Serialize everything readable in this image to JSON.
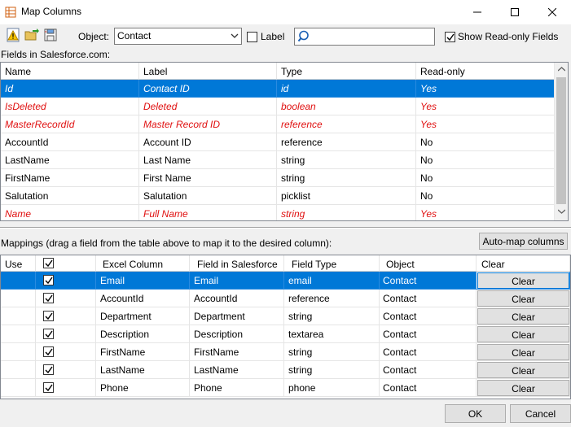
{
  "window": {
    "title": "Map Columns",
    "minimize_icon": "minimize-icon",
    "maximize_icon": "maximize-icon",
    "close_icon": "close-icon"
  },
  "toolbar": {
    "icons": [
      "warning-document-icon",
      "open-folder-icon",
      "save-disk-icon"
    ],
    "object_label": "Object:",
    "object_value": "Contact",
    "label_checkbox": {
      "label": "Label",
      "checked": false
    },
    "search_value": "",
    "show_readonly": {
      "label": "Show Read-only Fields",
      "checked": true
    }
  },
  "fields": {
    "caption": "Fields in Salesforce.com:",
    "columns": [
      "Name",
      "Label",
      "Type",
      "Read-only"
    ],
    "rows": [
      {
        "name": "Id",
        "label": "Contact ID",
        "type": "id",
        "readonly": "Yes",
        "selected": true,
        "ro": true
      },
      {
        "name": "IsDeleted",
        "label": "Deleted",
        "type": "boolean",
        "readonly": "Yes",
        "selected": false,
        "ro": true
      },
      {
        "name": "MasterRecordId",
        "label": "Master Record ID",
        "type": "reference",
        "readonly": "Yes",
        "selected": false,
        "ro": true
      },
      {
        "name": "AccountId",
        "label": "Account ID",
        "type": "reference",
        "readonly": "No",
        "selected": false,
        "ro": false
      },
      {
        "name": "LastName",
        "label": "Last Name",
        "type": "string",
        "readonly": "No",
        "selected": false,
        "ro": false
      },
      {
        "name": "FirstName",
        "label": "First Name",
        "type": "string",
        "readonly": "No",
        "selected": false,
        "ro": false
      },
      {
        "name": "Salutation",
        "label": "Salutation",
        "type": "picklist",
        "readonly": "No",
        "selected": false,
        "ro": false
      },
      {
        "name": "Name",
        "label": "Full Name",
        "type": "string",
        "readonly": "Yes",
        "selected": false,
        "ro": true
      }
    ]
  },
  "mappings": {
    "caption": "Mappings (drag a field from the table above to map it to the desired column):",
    "automap_label": "Auto-map columns",
    "columns": [
      "Use",
      "Excel Column",
      "Field in Salesforce",
      "Field Type",
      "Object",
      "Clear"
    ],
    "header_checked": true,
    "rows": [
      {
        "use": true,
        "excel": "Email",
        "field": "Email",
        "type": "email",
        "object": "Contact",
        "clear": "Clear",
        "selected": true
      },
      {
        "use": true,
        "excel": "AccountId",
        "field": "AccountId",
        "type": "reference",
        "object": "Contact",
        "clear": "Clear",
        "selected": false
      },
      {
        "use": true,
        "excel": "Department",
        "field": "Department",
        "type": "string",
        "object": "Contact",
        "clear": "Clear",
        "selected": false
      },
      {
        "use": true,
        "excel": "Description",
        "field": "Description",
        "type": "textarea",
        "object": "Contact",
        "clear": "Clear",
        "selected": false
      },
      {
        "use": true,
        "excel": "FirstName",
        "field": "FirstName",
        "type": "string",
        "object": "Contact",
        "clear": "Clear",
        "selected": false
      },
      {
        "use": true,
        "excel": "LastName",
        "field": "LastName",
        "type": "string",
        "object": "Contact",
        "clear": "Clear",
        "selected": false
      },
      {
        "use": true,
        "excel": "Phone",
        "field": "Phone",
        "type": "phone",
        "object": "Contact",
        "clear": "Clear",
        "selected": false
      }
    ]
  },
  "buttons": {
    "ok": "OK",
    "cancel": "Cancel"
  },
  "colors": {
    "selection": "#0078d7",
    "readonly_text": "#e01010",
    "window_bg": "#f0f0f0"
  }
}
